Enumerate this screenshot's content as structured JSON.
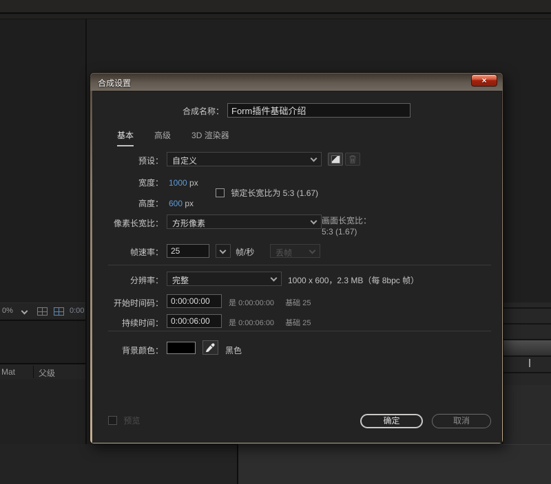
{
  "window": {
    "title": "合成设置",
    "close_glyph": "×"
  },
  "dialog": {
    "name_label": "合成名称：",
    "name_value": "Form插件基础介绍",
    "tabs": [
      {
        "label": "基本"
      },
      {
        "label": "高级"
      },
      {
        "label": "3D 渲染器"
      }
    ],
    "preset_label": "预设：",
    "preset_value": "自定义",
    "width_label": "宽度：",
    "width_value": "1000",
    "width_unit": "px",
    "height_label": "高度：",
    "height_value": "600",
    "height_unit": "px",
    "lock_aspect_label": "锁定长宽比为 5:3 (1.67)",
    "pixel_aspect_label": "像素长宽比：",
    "pixel_aspect_value": "方形像素",
    "frame_aspect_label": "画面长宽比：",
    "frame_aspect_value": "5:3 (1.67)",
    "frame_rate_label": "帧速率：",
    "frame_rate_value": "25",
    "frame_rate_unit": "帧/秒",
    "drop_frame_value": "丢帧",
    "resolution_label": "分辨率：",
    "resolution_value": "完整",
    "resolution_info": "1000 x 600，2.3 MB（每 8bpc 帧）",
    "start_timecode_label": "开始时间码：",
    "start_timecode_value": "0:00:00:00",
    "start_timecode_is": "是",
    "start_timecode_actual": "0:00:00:00",
    "start_timecode_base": "基础 25",
    "duration_label": "持续时间：",
    "duration_value": "0:00:06:00",
    "duration_is": "是",
    "duration_actual": "0:00:06:00",
    "duration_base": "基础 25",
    "bg_color_label": "背景颜色：",
    "bg_color_hex": "#000000",
    "bg_color_name": "黑色",
    "preview_label": "预览",
    "ok_label": "确定",
    "cancel_label": "取消"
  },
  "background_ui": {
    "zoom_value": "0%",
    "timecode": "0:00",
    "trkmat_label": "Mat",
    "parent_label": "父级"
  },
  "colors": {
    "accent_blue": "#5e9cd8",
    "dialog_bg": "#232323",
    "frame_tan": "#a2927c",
    "close_red": "#a3230f"
  }
}
